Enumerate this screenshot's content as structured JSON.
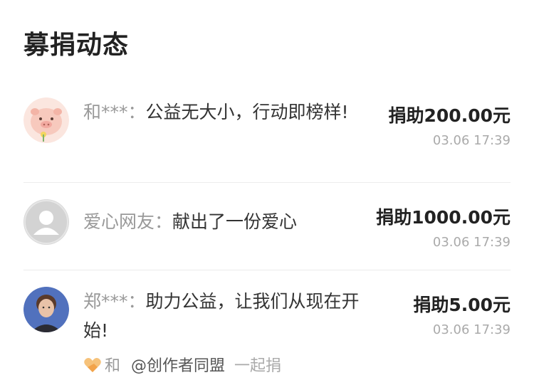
{
  "header": {
    "title": "募捐动态"
  },
  "donations": [
    {
      "name": "和***：",
      "message": "公益无大小，行动即榜样!",
      "amount": "捐助200.00元",
      "time": "03.06 17:39",
      "avatar_icon": "pig-avatar-icon"
    },
    {
      "name": "爱心网友：",
      "message": "献出了一份爱心",
      "amount": "捐助1000.00元",
      "time": "03.06 17:39",
      "avatar_icon": "default-user-avatar-icon"
    },
    {
      "name": "郑***：",
      "message": "助力公益，让我们从现在开始!",
      "amount": "捐助5.00元",
      "time": "03.06 17:39",
      "avatar_icon": "user-photo-avatar-icon",
      "cojoin": {
        "prefix": "和",
        "user": "@创作者同盟",
        "suffix": "一起捐",
        "icon": "heart-hands-icon"
      }
    }
  ],
  "colors": {
    "text_primary": "#222222",
    "text_name": "#999999",
    "text_time": "#aaaaaa",
    "divider": "#ececec",
    "heart_orange": "#f2a34a"
  }
}
